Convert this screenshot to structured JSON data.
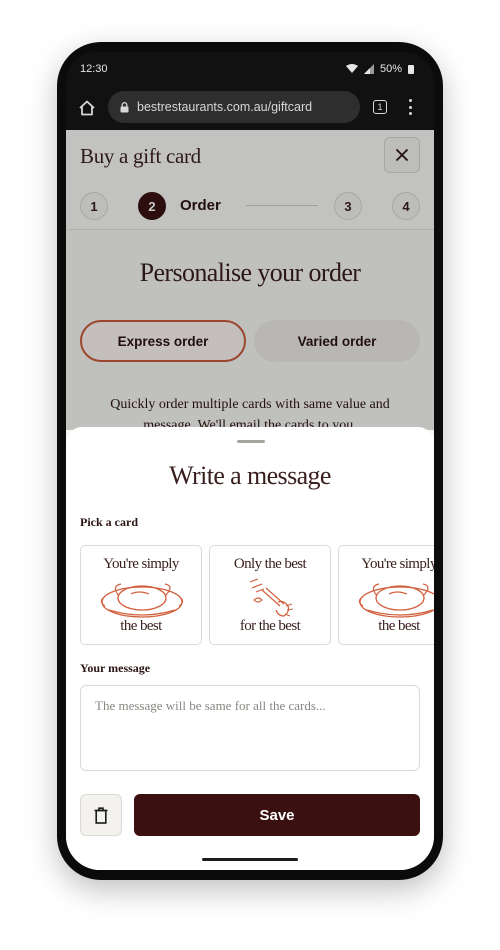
{
  "status_bar": {
    "time": "12:30",
    "battery": "50%"
  },
  "browser": {
    "url": "bestrestaurants.com.au/giftcard",
    "tab_count": "1"
  },
  "header": {
    "title": "Buy a gift card"
  },
  "stepper": {
    "steps": [
      {
        "number": "1"
      },
      {
        "number": "2",
        "label": "Order",
        "active": true
      },
      {
        "number": "3"
      },
      {
        "number": "4"
      }
    ]
  },
  "personalise": {
    "title": "Personalise your order",
    "express_label": "Express order",
    "varied_label": "Varied order",
    "description": "Quickly order multiple cards with same value and message. We'll email the cards to you."
  },
  "sheet": {
    "title": "Write a message",
    "pick_card_label": "Pick a card",
    "cards": [
      {
        "top": "You're simply",
        "bottom": "the best",
        "icon": "turkey-illustration"
      },
      {
        "top": "Only the best",
        "bottom": "for the best",
        "icon": "fork-illustration"
      },
      {
        "top": "You're simply",
        "bottom": "the best",
        "icon": "turkey-illustration"
      }
    ],
    "message_label": "Your message",
    "message_placeholder": "The message will be same for all the cards...",
    "save_label": "Save"
  },
  "colors": {
    "accent": "#c85a3a",
    "brand_dark": "#3a1010",
    "text": "#2b1414"
  }
}
